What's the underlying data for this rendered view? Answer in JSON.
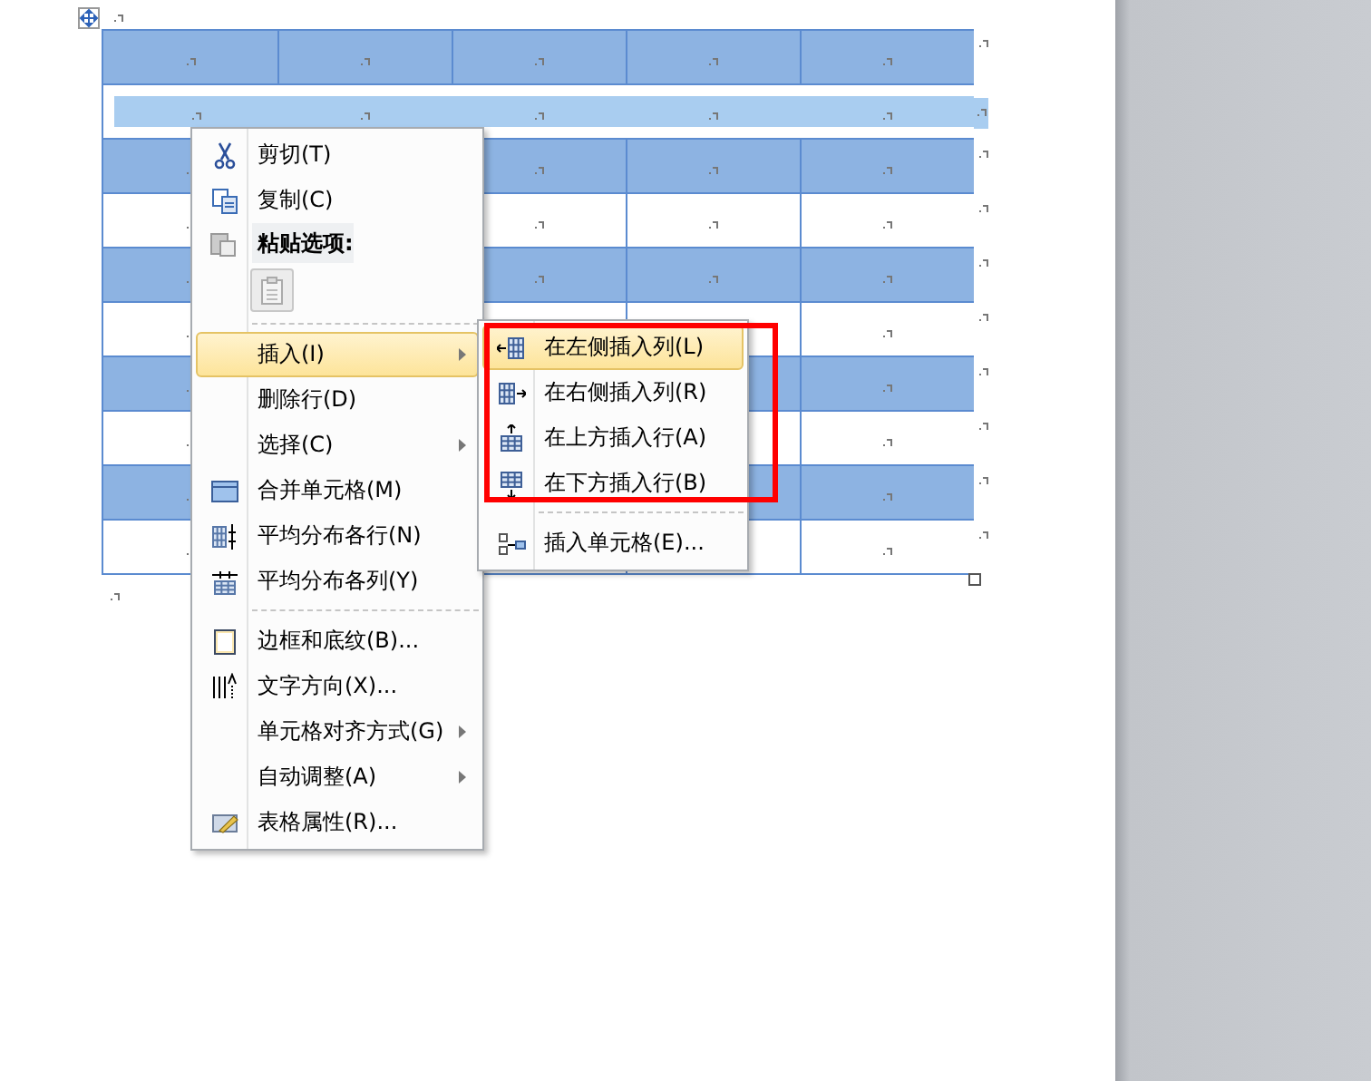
{
  "table": {
    "rows": [
      {
        "shaded": true,
        "selected": false
      },
      {
        "shaded": false,
        "selected": true
      },
      {
        "shaded": true,
        "selected": false
      },
      {
        "shaded": false,
        "selected": false
      },
      {
        "shaded": true,
        "selected": false
      },
      {
        "shaded": false,
        "selected": false
      },
      {
        "shaded": true,
        "selected": false
      },
      {
        "shaded": false,
        "selected": false
      },
      {
        "shaded": true,
        "selected": false
      },
      {
        "shaded": false,
        "selected": false
      }
    ]
  },
  "context_menu": {
    "items": [
      {
        "kind": "item",
        "label": "剪切(T)",
        "submenu": false,
        "selected": false
      },
      {
        "kind": "item",
        "label": "复制(C)",
        "submenu": false,
        "selected": false
      },
      {
        "kind": "header",
        "label": "粘贴选项:"
      },
      {
        "kind": "paste-options"
      },
      {
        "kind": "separator"
      },
      {
        "kind": "item",
        "label": "插入(I)",
        "submenu": true,
        "selected": true
      },
      {
        "kind": "item",
        "label": "删除行(D)",
        "submenu": false,
        "selected": false
      },
      {
        "kind": "item",
        "label": "选择(C)",
        "submenu": true,
        "selected": false
      },
      {
        "kind": "item",
        "label": "合并单元格(M)",
        "submenu": false,
        "selected": false
      },
      {
        "kind": "item",
        "label": "平均分布各行(N)",
        "submenu": false,
        "selected": false
      },
      {
        "kind": "item",
        "label": "平均分布各列(Y)",
        "submenu": false,
        "selected": false
      },
      {
        "kind": "separator"
      },
      {
        "kind": "item",
        "label": "边框和底纹(B)...",
        "submenu": false,
        "selected": false
      },
      {
        "kind": "item",
        "label": "文字方向(X)...",
        "submenu": false,
        "selected": false
      },
      {
        "kind": "item",
        "label": "单元格对齐方式(G)",
        "submenu": true,
        "selected": false
      },
      {
        "kind": "item",
        "label": "自动调整(A)",
        "submenu": true,
        "selected": false
      },
      {
        "kind": "item",
        "label": "表格属性(R)...",
        "submenu": false,
        "selected": false
      }
    ]
  },
  "submenu": {
    "items": [
      {
        "kind": "item",
        "label": "在左侧插入列(L)",
        "selected": true
      },
      {
        "kind": "item",
        "label": "在右侧插入列(R)",
        "selected": false
      },
      {
        "kind": "item",
        "label": "在上方插入行(A)",
        "selected": false
      },
      {
        "kind": "item",
        "label": "在下方插入行(B)",
        "selected": false
      },
      {
        "kind": "separator"
      },
      {
        "kind": "item",
        "label": "插入单元格(E)...",
        "selected": false
      }
    ],
    "highlight_frame": true
  }
}
